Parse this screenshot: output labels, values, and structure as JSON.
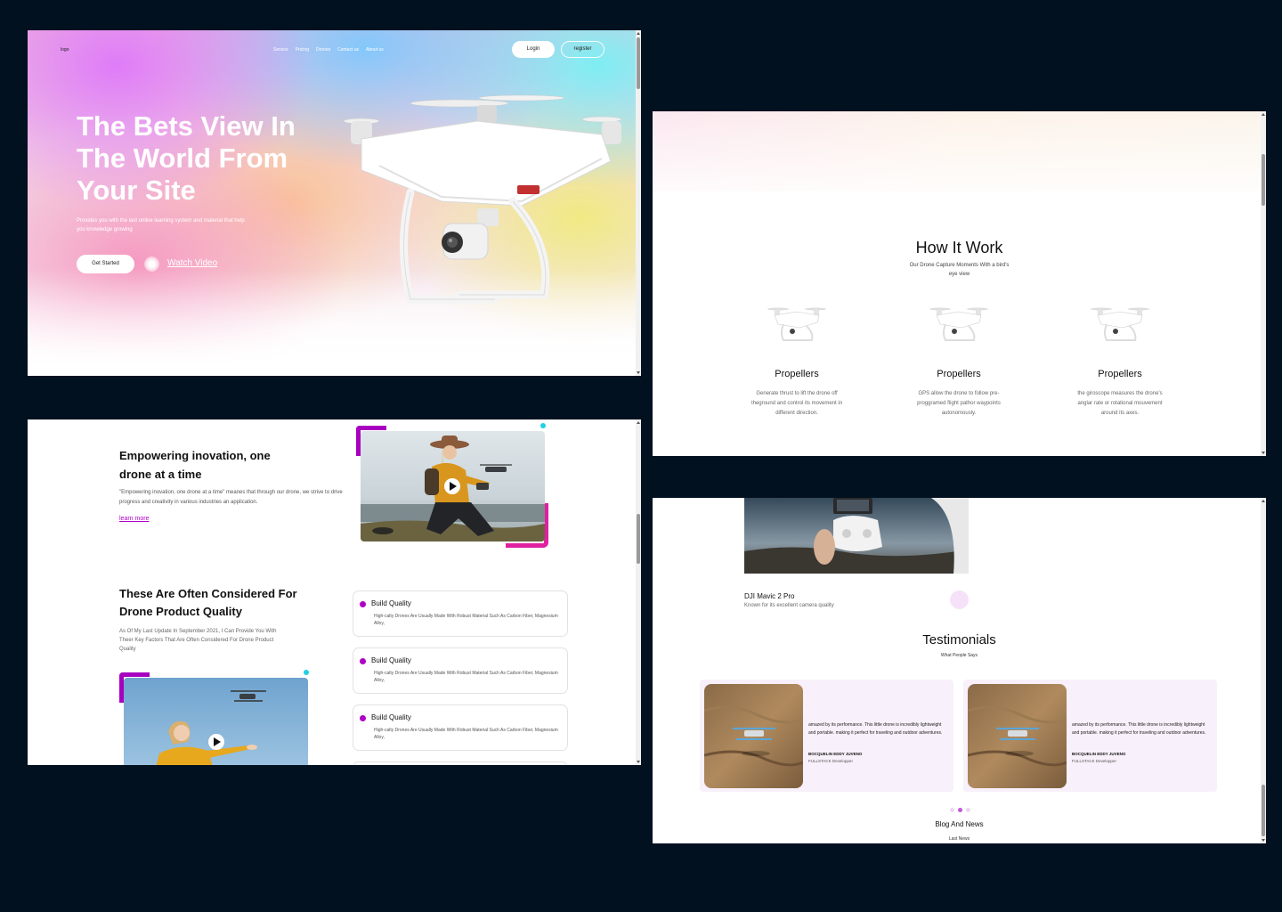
{
  "hero": {
    "logo": "logo",
    "nav": [
      "Service",
      "Pricing",
      "Drones",
      "Contact us",
      "About us"
    ],
    "login": "Login",
    "register": "register",
    "title": "The Bets View In The World From Your Site",
    "subtitle": "Provides you with the last online learning system and material that help you knowledge growing",
    "get_started": "Get Started",
    "watch_video": "Watch Video"
  },
  "how": {
    "title": "How It Work",
    "subtitle": "Our Drone Capture Moments With a bird's eye view",
    "features": [
      {
        "title": "Propellers",
        "desc": "Generate thrust to lift the drone off theground and control its movement in different direction."
      },
      {
        "title": "Propellers",
        "desc": "GPS allow the drone to follow pre-proggramed flight pathor waypoints autonomously."
      },
      {
        "title": "Propellers",
        "desc": "the giroscope measures the drone's anglar rate or rotational mouvement around its axes."
      }
    ]
  },
  "about": {
    "heading": "Empowering inovation, one drone at a time",
    "text": "\"Empowering inovation, one drone at a time\" meanes that through our drone, we strive to drive progress and creativity in various industries an application.",
    "learn_more": "learn more",
    "quality_heading": "These Are Often Considered For Drone Product Quality",
    "quality_text": "As Of My Last Update In September 2021, I Can Provide You With Theer Key Factors That Are Often Considered For Drone Product Quality",
    "cards": [
      {
        "title": "Build Quality",
        "desc": "High-calty Drones Are Usually Made With Robust Material Such As Carbon Fiber, Magnesium Alloy,"
      },
      {
        "title": "Build Quality",
        "desc": "High-calty Drones Are Usually Made With Robust Material Such As Carbon Fiber, Magnesium Alloy,"
      },
      {
        "title": "Build Quality",
        "desc": "High-calty Drones Are Usually Made With Robust Material Such As Carbon Fiber, Magnesium Alloy,"
      }
    ]
  },
  "testimonials": {
    "product_name": "DJI Mavic 2 Pro",
    "product_desc": "Known for its excellent camera quality",
    "title": "Testimonials",
    "subtitle": "What People Says",
    "items": [
      {
        "quote": "amazed by its performance. This little drone is incredibly lightweight and portable. making it perfect for traveling and outdoor adventures.",
        "name": "BOCQUELIN EDDY JUVENO",
        "role": "FULLSTACK Developper"
      },
      {
        "quote": "amazed by its performance. This little drone is incredibly lightweight and portable. making it perfect for traveling and outdoor adventures.",
        "name": "BOCQUELIN EDDY JUVENO",
        "role": "FULLSTACK Developper"
      }
    ],
    "blog_title": "Blog And News",
    "blog_sub": "Last News"
  },
  "colors": {
    "accent_purple": "#a800c0",
    "accent_pink": "#e020a0",
    "accent_cyan": "#20d0e0",
    "background": "#02111f"
  }
}
